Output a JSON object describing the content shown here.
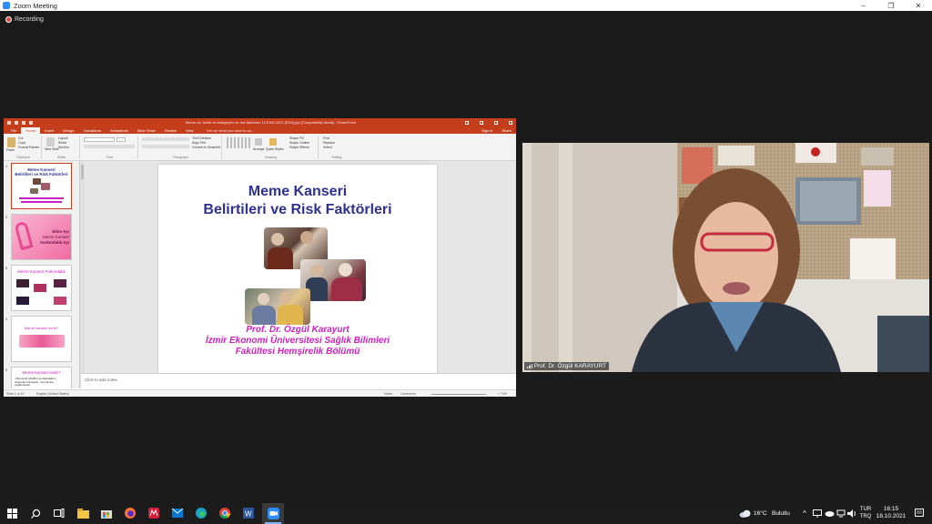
{
  "window": {
    "title": "Zoom Meeting",
    "controls": [
      "–",
      "❐",
      "✕"
    ]
  },
  "recording": {
    "label": "Recording"
  },
  "powerpoint": {
    "doc_title": "Meme ca. belirti ve belirgeçler ve risk faktörleri 12.EKM.2021 [ESA].ppt [Compatibility Mode] - PowerPoint",
    "tabs": [
      "File",
      "Home",
      "Insert",
      "Design",
      "Transitions",
      "Animations",
      "Slide Show",
      "Review",
      "View"
    ],
    "active_tab": "Home",
    "tell_me": "Tell me what you want to do...",
    "sign_in": "Sign in",
    "share": "Share",
    "ribbon": {
      "paste": "Paste",
      "cut": "Cut",
      "copy": "Copy",
      "format_painter": "Format Painter",
      "clipboard": "Clipboard",
      "new_slide": "New Slide",
      "layout": "Layout",
      "reset": "Reset",
      "section": "Section",
      "slides": "Slides",
      "font": "Font",
      "paragraph": "Paragraph",
      "text_direction": "Text Direction",
      "align_text": "Align Text",
      "convert_smartart": "Convert to SmartArt",
      "arrange": "Arrange",
      "quick_styles": "Quick Styles",
      "shape_fill": "Shape Fill",
      "shape_outline": "Shape Outline",
      "shape_effects": "Shape Effects",
      "drawing": "Drawing",
      "find": "Find",
      "replace": "Replace",
      "select": "Select",
      "editing": "Editing"
    },
    "thumbnails": [
      {
        "num": "1",
        "lines": [
          "Meme Kanseri",
          "Belirtileri ve Risk Faktörleri"
        ]
      },
      {
        "num": "2",
        "lines": [
          "Ekim Ayı",
          "Meme Kanseri",
          "Farkındalık Ayı"
        ]
      },
      {
        "num": "3",
        "lines": [
          "Meme Kanseri Farkındalık"
        ]
      },
      {
        "num": "4",
        "lines": [
          "Meme kanseri nedir?"
        ]
      },
      {
        "num": "5",
        "lines": [
          "Meme kanseri nedir?",
          "• Memenin lobülleri ve duktuslarını",
          "oluşturan hücrelerin, normal dışı",
          "çoğalmasıdır."
        ]
      }
    ],
    "slide": {
      "title_line1": "Meme Kanseri",
      "title_line2": "Belirtileri ve Risk Faktörleri",
      "author_line1": "Prof. Dr. Özgül Karayurt",
      "author_line2": "İzmir Ekonomi Üniversitesi Sağlık Bilimleri",
      "author_line3": "Fakültesi Hemşirelik Bölümü"
    },
    "notes_placeholder": "Click to add notes",
    "status": {
      "slide_count": "Slide 1 of 19",
      "language": "English (United States)",
      "notes": "Notes",
      "comments": "Comments",
      "zoom": "+ 74%"
    }
  },
  "video": {
    "participant_name": "Prof. Dr. Özgül KARAYURT"
  },
  "taskbar": {
    "weather_temp": "16°C",
    "weather_text": "Bulutlu",
    "lang_line1": "TUR",
    "lang_line2": "TRQ",
    "time": "16:15",
    "date": "18.10.2021",
    "colors": {
      "accent": "#2d8cff",
      "ppt": "#c43e1c",
      "magenta": "#d020c0",
      "navy": "#2e3192"
    }
  }
}
